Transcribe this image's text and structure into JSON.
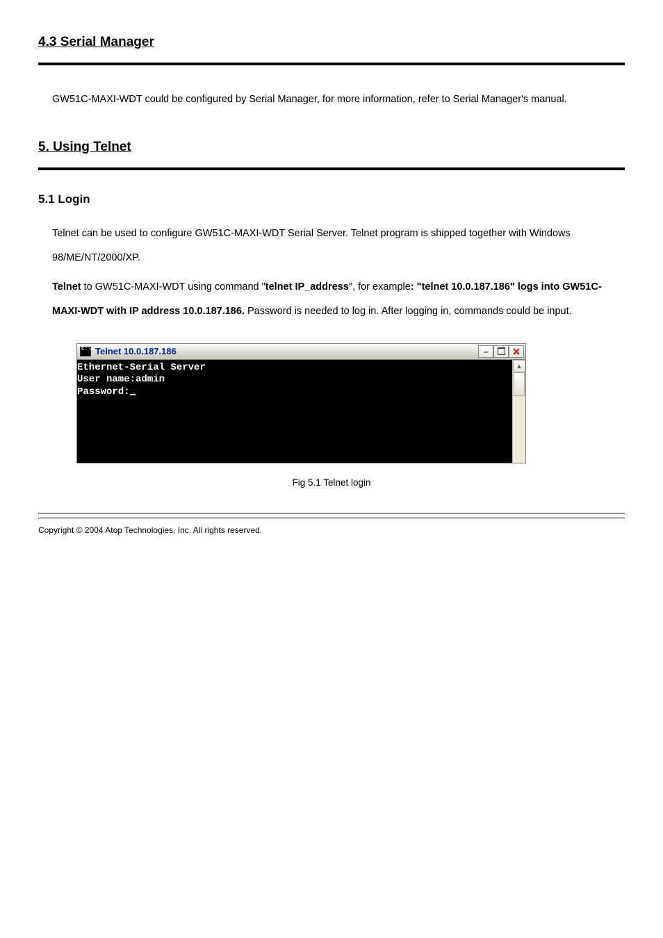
{
  "heading": "4.3 Serial Manager",
  "para_serial_manager": "GW51C-MAXI-WDT could be configured by Serial Manager, for more information, refer to Serial Manager's manual.",
  "heading_5": "5. Using Telnet",
  "subhead_51": "5.1 Login",
  "para_telnet_1": "Telnet can be used to configure GW51C-MAXI-WDT Serial Server. Telnet program is shipped together with Windows 98/ME/NT/2000/XP.",
  "para_telnet_2_parts": {
    "p1": "Telnet ",
    "p2": "to GW51C-MAXI-WDT ",
    "p3": "using command \"",
    "p4": "telnet IP_address",
    "p5": "\", for example",
    "p6": ": \"",
    "p7": "telnet 10.0.187.186",
    "p8": "\" logs into GW51C-MAXI-WDT with IP address 10.0.187.186.",
    "p9": " Password is needed to log in. After logging in, commands could be input."
  },
  "telnet_window": {
    "title": "Telnet 10.0.187.186",
    "lines": [
      "Ethernet-Serial Server",
      "User name:admin",
      "Password:"
    ]
  },
  "caption": "Fig 5.1 Telnet login",
  "footer_left": "Copyright © 2004 Atop Technologies, Inc. All rights reserved.",
  "footer_right": " "
}
